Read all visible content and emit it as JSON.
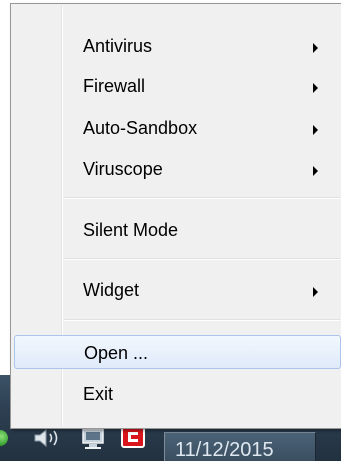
{
  "taskbar": {
    "clock_date": "11/12/2015",
    "tray_icons": [
      "volume-icon",
      "network-icon",
      "comodo-icon"
    ]
  },
  "context_menu": {
    "groups": [
      {
        "items": [
          {
            "label": "Antivirus",
            "has_submenu": true
          },
          {
            "label": "Firewall",
            "has_submenu": true
          },
          {
            "label": "Auto-Sandbox",
            "has_submenu": true
          },
          {
            "label": "Viruscope",
            "has_submenu": true
          }
        ]
      },
      {
        "items": [
          {
            "label": "Silent Mode",
            "has_submenu": false
          }
        ]
      },
      {
        "items": [
          {
            "label": "Widget",
            "has_submenu": true
          }
        ]
      },
      {
        "items": [
          {
            "label": "Open ...",
            "has_submenu": false,
            "highlighted": true
          },
          {
            "label": "Exit",
            "has_submenu": false
          }
        ]
      }
    ]
  },
  "colors": {
    "menu_background": "#f0f0f0",
    "highlight_border": "#a9c5ea",
    "taskbar": "#2c3e50",
    "comodo_red": "#d9161c"
  }
}
